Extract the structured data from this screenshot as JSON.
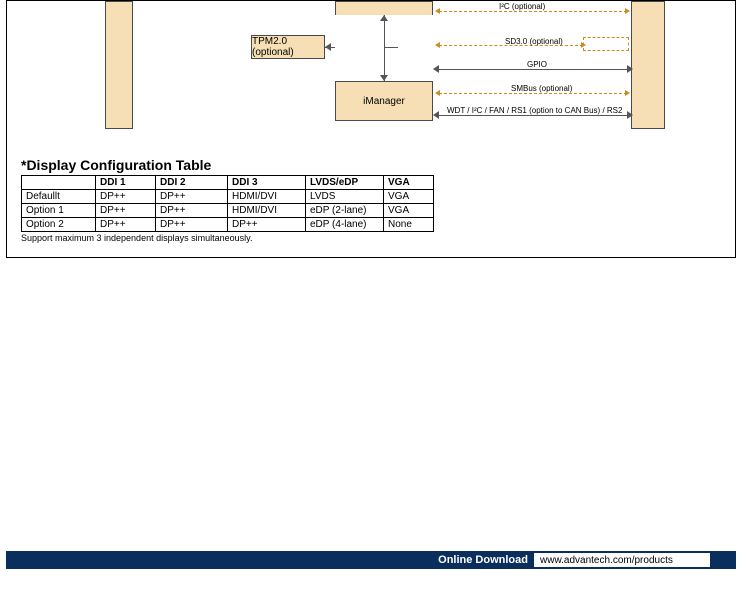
{
  "diagram": {
    "blocks": {
      "tpm": "TPM2.0 (optional)",
      "imanager": "iManager"
    },
    "signals": {
      "i2c": "I²C (optional)",
      "sd30": "SD3.0 (optional)",
      "gpio": "GPIO",
      "smbus": "SMBus (optional)",
      "wdt": "WDT / I²C / FAN / RS1 (option to CAN Bus) / RS2"
    }
  },
  "table": {
    "title": "*Display Configuration Table",
    "headers": [
      "",
      "DDI 1",
      "DDI 2",
      "DDI 3",
      "LVDS/eDP",
      "VGA"
    ],
    "rows": [
      [
        "Defaullt",
        "DP++",
        "DP++",
        "HDMI/DVI",
        "LVDS",
        "VGA"
      ],
      [
        "Option 1",
        "DP++",
        "DP++",
        "HDMI/DVI",
        "eDP (2-lane)",
        "VGA"
      ],
      [
        "Option 2",
        "DP++",
        "DP++",
        "DP++",
        "eDP (4-lane)",
        "None"
      ]
    ],
    "footnote": "Support maximum 3 independent displays simultaneously."
  },
  "footer": {
    "label": "Online Download",
    "url": "www.advantech.com/products"
  }
}
